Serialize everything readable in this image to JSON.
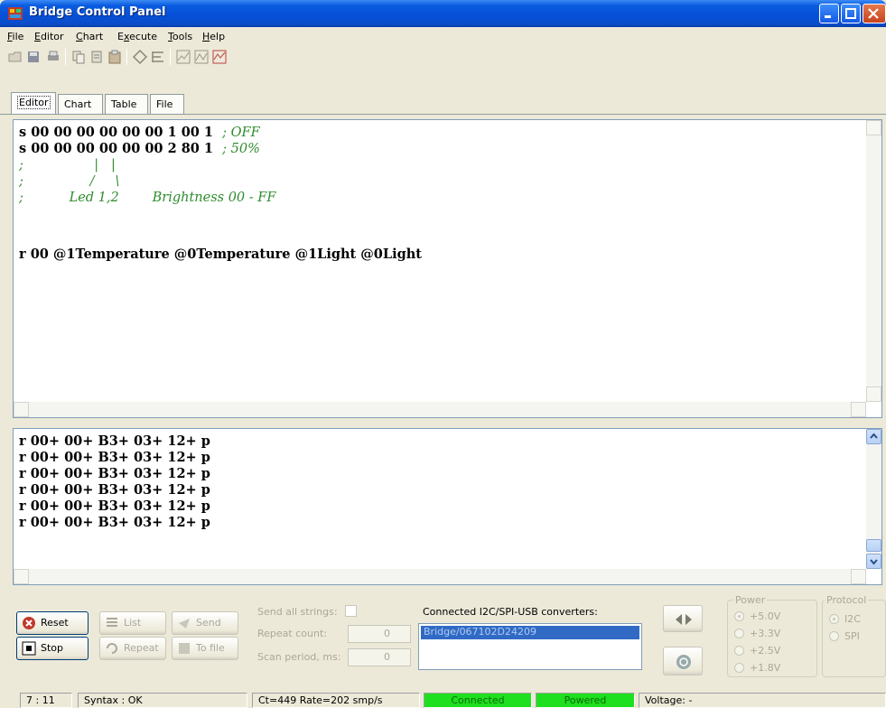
{
  "window": {
    "title": "Bridge Control Panel"
  },
  "menu": [
    {
      "label": "File",
      "ul": "F",
      "rest": "ile"
    },
    {
      "label": "Editor",
      "ul": "E",
      "rest": "ditor"
    },
    {
      "label": "Chart",
      "ul": "C",
      "rest": "hart"
    },
    {
      "label": "Execute",
      "pre": "E",
      "ul": "x",
      "rest": "ecute"
    },
    {
      "label": "Tools",
      "ul": "T",
      "rest": "ools"
    },
    {
      "label": "Help",
      "ul": "H",
      "rest": "elp"
    }
  ],
  "toolbar_icons": [
    "open-file-icon",
    "save-icon",
    "print-icon",
    "copy-icon",
    "cut-icon",
    "paste-icon",
    "comment-icon",
    "align-icon",
    "chart-icon",
    "chart-settings-icon",
    "chart-export-icon"
  ],
  "tabs": [
    "Editor",
    "Chart",
    "Table",
    "File"
  ],
  "editor": {
    "lines": [
      {
        "code": "s 00 00 00 00 00 00 1 00 1  ",
        "comment": "; OFF"
      },
      {
        "code": "s 00 00 00 00 00 00 2 80 1  ",
        "comment": "; 50%"
      },
      {
        "code": "",
        "comment": ";                 |   |"
      },
      {
        "code": "",
        "comment": ";                /     \\"
      },
      {
        "code": "",
        "comment": ";           Led 1,2        Brightness 00 - FF"
      },
      {
        "code": "",
        "comment": ""
      },
      {
        "code": "r 00 @1Temperature @0Temperature @1Light @0Light",
        "comment": ""
      }
    ]
  },
  "output": {
    "lines": [
      "r 00+ 00+ B3+ 03+ 12+ p",
      "r 00+ 00+ B3+ 03+ 12+ p",
      "r 00+ 00+ B3+ 03+ 12+ p",
      "r 00+ 00+ B3+ 03+ 12+ p",
      "r 00+ 00+ B3+ 03+ 12+ p",
      "r 00+ 00+ B3+ 03+ 12+ p"
    ]
  },
  "controls": {
    "reset": "Reset",
    "stop": "Stop",
    "list": "List",
    "repeat": "Repeat",
    "send": "Send",
    "to_file": "To file",
    "send_all_label": "Send all strings:",
    "repeat_count_label": "Repeat count:",
    "repeat_count_value": "0",
    "scan_period_label": "Scan period, ms:",
    "scan_period_value": "0",
    "converters_label": "Connected I2C/SPI-USB converters:",
    "converter_item": "Bridge/067102D24209"
  },
  "power": {
    "title": "Power",
    "options": [
      "+5.0V",
      "+3.3V",
      "+2.5V",
      "+1.8V"
    ],
    "selected": "+5.0V"
  },
  "protocol": {
    "title": "Protocol",
    "options": [
      "I2C",
      "SPI"
    ],
    "selected": "I2C"
  },
  "status": {
    "cursor": "7 : 11",
    "syntax": "Syntax : OK",
    "rate": "Ct=449 Rate=202 smp/s",
    "connected": "Connected",
    "powered": "Powered",
    "voltage": "Voltage: -"
  },
  "colors": {
    "comment": "#2e8b2e",
    "status_green": "#1ee01e",
    "selection": "#316ac5"
  }
}
